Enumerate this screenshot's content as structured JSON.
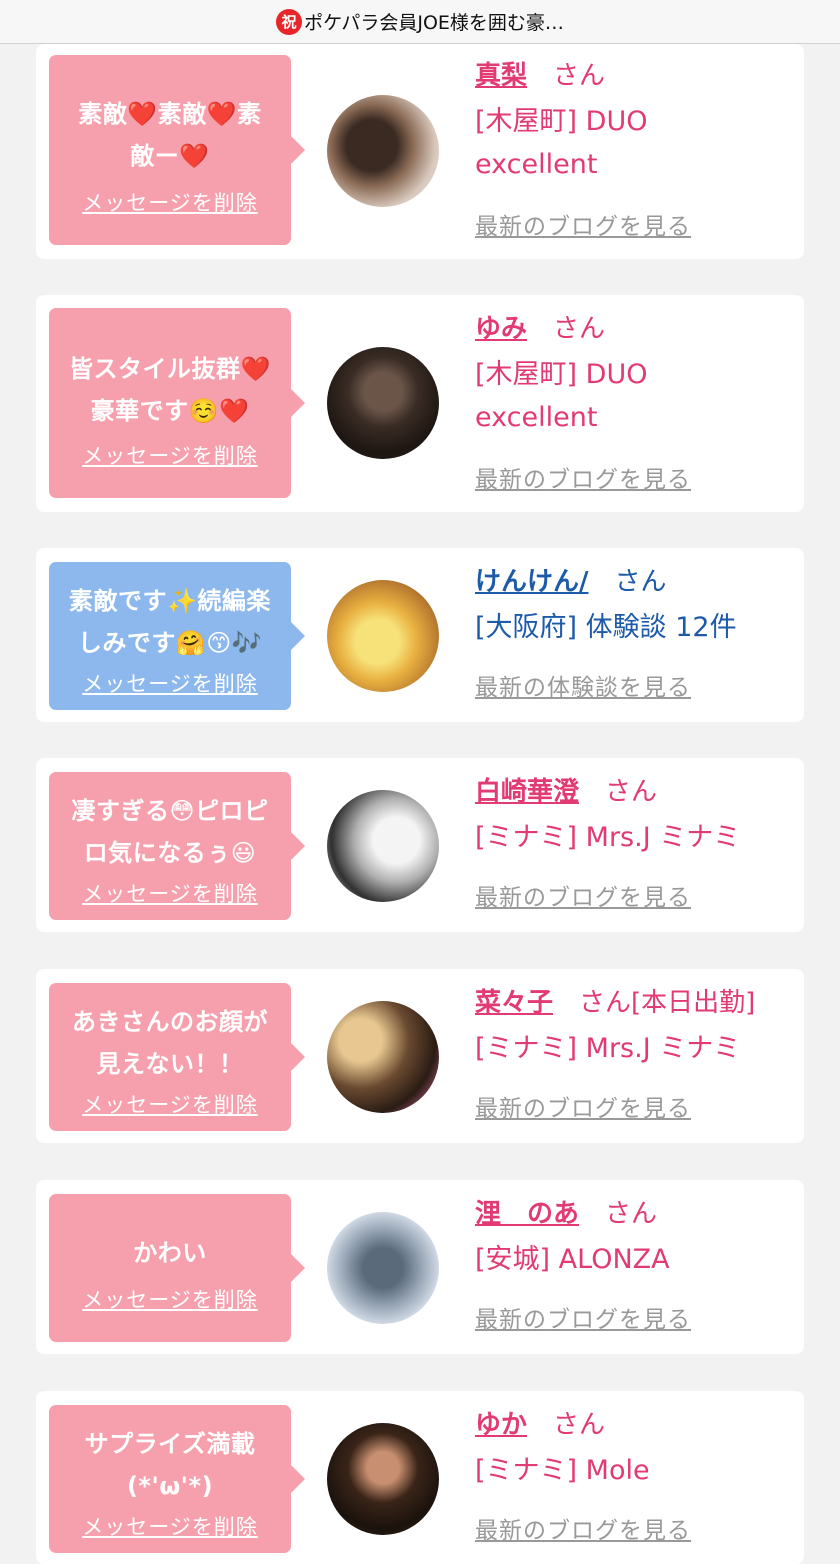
{
  "header": {
    "badge": "祝",
    "title": "ポケパラ会員JOE様を囲む豪…"
  },
  "delete_label": "メッセージを削除",
  "cards": [
    {
      "message": "素敵❤️素敵❤️素\n敵ー❤️",
      "name": "真梨",
      "san": "さん",
      "shop": "[木屋町] DUO\nexcellent",
      "blog": "最新のブログを見る"
    },
    {
      "message": "皆スタイル抜群❤️\n豪華です☺️❤️",
      "name": "ゆみ",
      "san": "さん",
      "shop": "[木屋町] DUO\nexcellent",
      "blog": "最新のブログを見る"
    },
    {
      "message": "素敵です✨続編楽\nしみです🤗😙🎶",
      "name": "けんけん/",
      "san": "さん",
      "shop": "[大阪府] 体験談 12件",
      "blog": "最新の体験談を見る"
    },
    {
      "message": "凄すぎる😳ピロピ\nロ気になるぅ😃",
      "name": "白崎華澄",
      "san": "さん",
      "shop": "[ミナミ] Mrs.J ミナミ",
      "blog": "最新のブログを見る"
    },
    {
      "message": "あきさんのお顔が\n見えない！！",
      "name": "菜々子",
      "san": "さん[本日出勤]",
      "shop": "[ミナミ] Mrs.J ミナミ",
      "blog": "最新のブログを見る"
    },
    {
      "message": "かわい",
      "name": "浬　のあ",
      "san": "さん",
      "shop": "[安城] ALONZA",
      "blog": "最新のブログを見る"
    },
    {
      "message": "サプライズ満載\n(*'ω'*)",
      "name": "ゆか",
      "san": "さん",
      "shop": "[ミナミ] Mole",
      "blog": "最新のブログを見る"
    }
  ],
  "colors": {
    "pink_bubble": "#f7a0ad",
    "blue_bubble": "#8db8ed",
    "name_pink": "#e23a72",
    "name_blue": "#1d5aa8"
  }
}
